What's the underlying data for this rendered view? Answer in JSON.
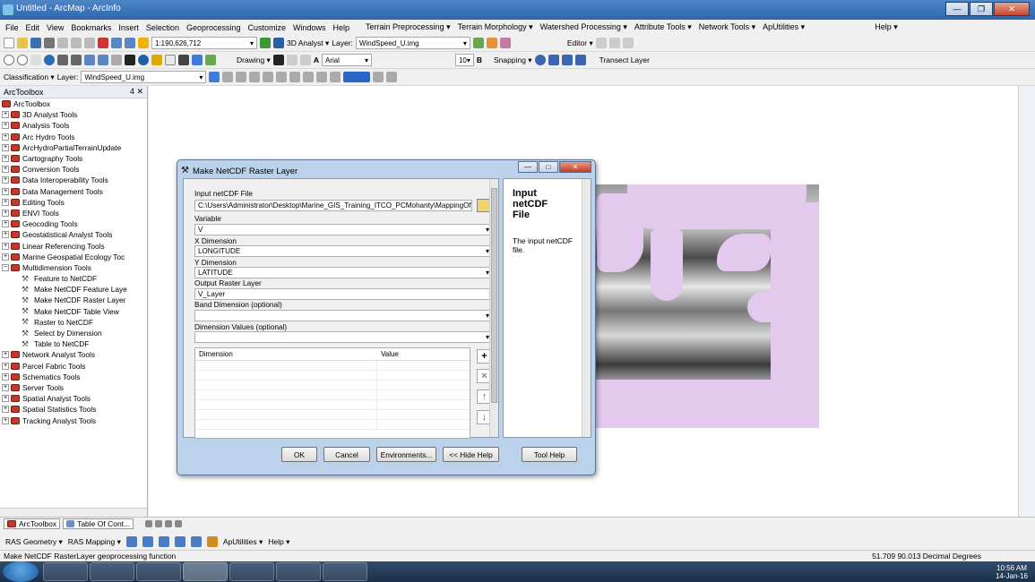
{
  "window": {
    "title": "Untitled - ArcMap - ArcInfo"
  },
  "menu": [
    "File",
    "Edit",
    "View",
    "Bookmarks",
    "Insert",
    "Selection",
    "Geoprocessing",
    "Customize",
    "Windows",
    "Help"
  ],
  "extensions_menu": [
    "Terrain Preprocessing ▾",
    "Terrain Morphology ▾",
    "Watershed Processing ▾",
    "Attribute Tools ▾",
    "Network Tools ▾",
    "ApUtilities ▾",
    "Help ▾"
  ],
  "toolbar": {
    "scale": "1:190,626,712",
    "analyst3d": "3D Analyst ▾",
    "layer_label": "Layer:",
    "layer_value": "WindSpeed_U.img",
    "editor": "Editor ▾",
    "drawing": "Drawing ▾",
    "font": "Arial",
    "font_size": "10",
    "bold": "B",
    "snapping": "Snapping ▾",
    "transect": "Transect Layer",
    "classification": "Classification ▾",
    "layer2_label": "Layer:",
    "layer2_value": "WindSpeed_U.img"
  },
  "toolbox": {
    "title": "ArcToolbox",
    "pin": "4 ✕",
    "root": "ArcToolbox",
    "items": [
      "3D Analyst Tools",
      "Analysis Tools",
      "Arc Hydro Tools",
      "ArcHydroPartialTerrainUpdate",
      "Cartography Tools",
      "Conversion Tools",
      "Data Interoperability Tools",
      "Data Management Tools",
      "Editing Tools",
      "ENVI Tools",
      "Geocoding Tools",
      "Geostatistical Analyst Tools",
      "Linear Referencing Tools",
      "Marine Geospatial Ecology Toc",
      "Multidimension Tools"
    ],
    "sub_items": [
      "Feature to NetCDF",
      "Make NetCDF Feature Laye",
      "Make NetCDF Raster Layer",
      "Make NetCDF Table View",
      "Raster to NetCDF",
      "Select by Dimension",
      "Table to NetCDF"
    ],
    "items_after": [
      "Network Analyst Tools",
      "Parcel Fabric Tools",
      "Schematics Tools",
      "Server Tools",
      "Spatial Analyst Tools",
      "Spatial Statistics Tools",
      "Tracking Analyst Tools"
    ]
  },
  "tabs": {
    "toolbox": "ArcToolbox",
    "toc": "Table Of Cont..."
  },
  "ras_toolbar": {
    "geometry": "RAS Geometry ▾",
    "mapping": "RAS Mapping ▾",
    "aputil": "ApUtilities ▾",
    "help": "Help ▾"
  },
  "status": {
    "message": "Make NetCDF RasterLayer geoprocessing function",
    "coords": "51.709  90.013 Decimal Degrees"
  },
  "clock": {
    "time": "10:56 AM",
    "date": "14-Jan-16"
  },
  "dialog": {
    "title": "Make NetCDF Raster Layer",
    "input_label": "Input netCDF File",
    "input_value": "C:\\Users\\Administrator\\Desktop\\Marine_GIS_Training_ITCO_PCMohanty\\MappingOfVe",
    "variable_label": "Variable",
    "variable_value": "V",
    "xdim_label": "X Dimension",
    "xdim_value": "LONGITUDE",
    "ydim_label": "Y Dimension",
    "ydim_value": "LATITUDE",
    "out_label": "Output Raster Layer",
    "out_value": "V_Layer",
    "band_label": "Band Dimension (optional)",
    "dimvals_label": "Dimension Values (optional)",
    "col_dimension": "Dimension",
    "col_value": "Value",
    "help_title": "Input netCDF File",
    "help_text": "The input netCDF file.",
    "ok": "OK",
    "cancel": "Cancel",
    "env": "Environments...",
    "hide_help": "<< Hide Help",
    "tool_help": "Tool Help"
  }
}
